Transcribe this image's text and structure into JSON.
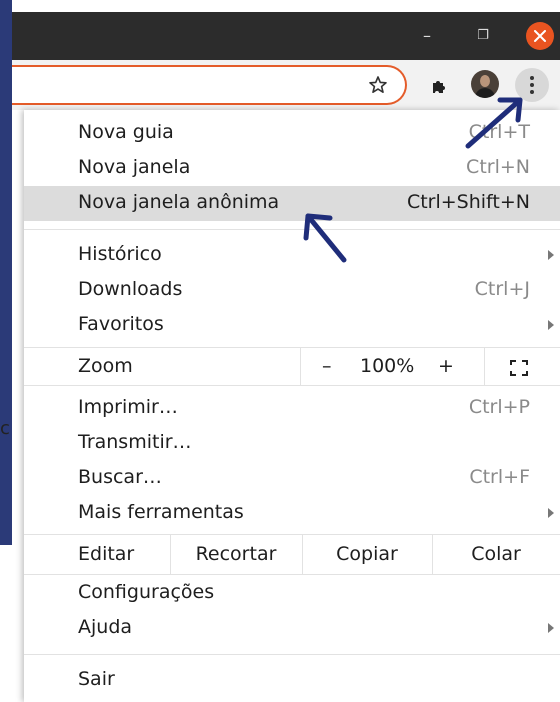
{
  "window": {
    "minimize_glyph": "–",
    "maximize_glyph": "❐"
  },
  "background": {
    "cutoff_text": "c"
  },
  "menu": {
    "items": [
      {
        "label": "Nova guia",
        "shortcut": "Ctrl+T"
      },
      {
        "label": "Nova janela",
        "shortcut": "Ctrl+N"
      },
      {
        "label": "Nova janela anônima",
        "shortcut": "Ctrl+Shift+N"
      },
      {
        "label": "Histórico"
      },
      {
        "label": "Downloads",
        "shortcut": "Ctrl+J"
      },
      {
        "label": "Favoritos"
      },
      {
        "label": "Zoom"
      },
      {
        "label": "Imprimir…",
        "shortcut": "Ctrl+P"
      },
      {
        "label": "Transmitir…"
      },
      {
        "label": "Buscar…",
        "shortcut": "Ctrl+F"
      },
      {
        "label": "Mais ferramentas"
      },
      {
        "label": "Configurações"
      },
      {
        "label": "Ajuda"
      },
      {
        "label": "Sair"
      }
    ],
    "zoom": {
      "minus": "–",
      "value": "100%",
      "plus": "+"
    },
    "edit": {
      "label": "Editar",
      "cut": "Recortar",
      "copy": "Copiar",
      "paste": "Colar"
    }
  },
  "icons": {
    "bookmark": "star-icon",
    "extensions": "puzzle-icon",
    "profile": "avatar",
    "menu": "kebab-menu-icon",
    "fullscreen": "fullscreen-icon",
    "close": "close-icon"
  },
  "colors": {
    "titlebar": "#2c2c2c",
    "close_button": "#e95420",
    "omnibox_border": "#e45c2a",
    "highlight": "#dcdcdc",
    "annotation_arrow": "#1f2d7a",
    "frame": "#2b3a78"
  }
}
